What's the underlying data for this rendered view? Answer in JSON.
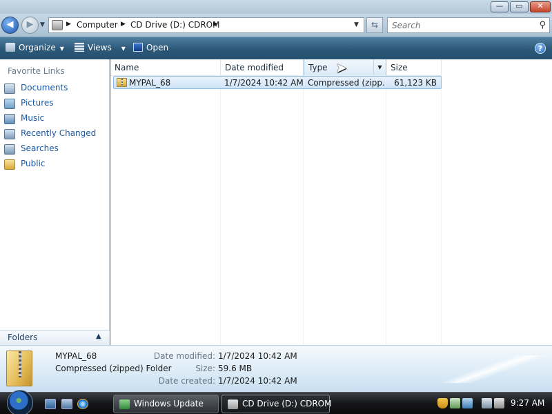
{
  "window": {
    "controls": {
      "minimize": "—",
      "maximize": "▭",
      "close": "✕"
    }
  },
  "address": {
    "crumbs": [
      "Computer",
      "CD Drive (D:) CDROM"
    ],
    "search_placeholder": "Search"
  },
  "toolbar": {
    "organize": "Organize",
    "views": "Views",
    "open": "Open",
    "help": "?"
  },
  "left_pane": {
    "title": "Favorite Links",
    "links": [
      {
        "label": "Documents",
        "icon": "documents-icon"
      },
      {
        "label": "Pictures",
        "icon": "pictures-icon"
      },
      {
        "label": "Music",
        "icon": "music-icon"
      },
      {
        "label": "Recently Changed",
        "icon": "recently-changed-icon"
      },
      {
        "label": "Searches",
        "icon": "searches-icon"
      },
      {
        "label": "Public",
        "icon": "public-folder-icon"
      }
    ],
    "folders_label": "Folders"
  },
  "file_list": {
    "columns": [
      "Name",
      "Date modified",
      "Type",
      "Size"
    ],
    "rows": [
      {
        "name": "MYPAL_68",
        "date_modified": "1/7/2024 10:42 AM",
        "type": "Compressed (zipp...",
        "size": "61,123 KB"
      }
    ]
  },
  "details": {
    "name": "MYPAL_68",
    "type": "Compressed (zipped) Folder",
    "fields": [
      {
        "label": "Date modified:",
        "value": "1/7/2024 10:42 AM"
      },
      {
        "label": "Size:",
        "value": "59.6 MB"
      },
      {
        "label": "Date created:",
        "value": "1/7/2024 10:42 AM"
      }
    ]
  },
  "taskbar": {
    "tasks": [
      "Windows Update",
      "CD Drive (D:) CDROM"
    ],
    "clock": "9:27 AM"
  },
  "colors": {
    "accent": "#1a59a4",
    "toolbar": "#2c5878",
    "selection": "#cfe4f8"
  }
}
